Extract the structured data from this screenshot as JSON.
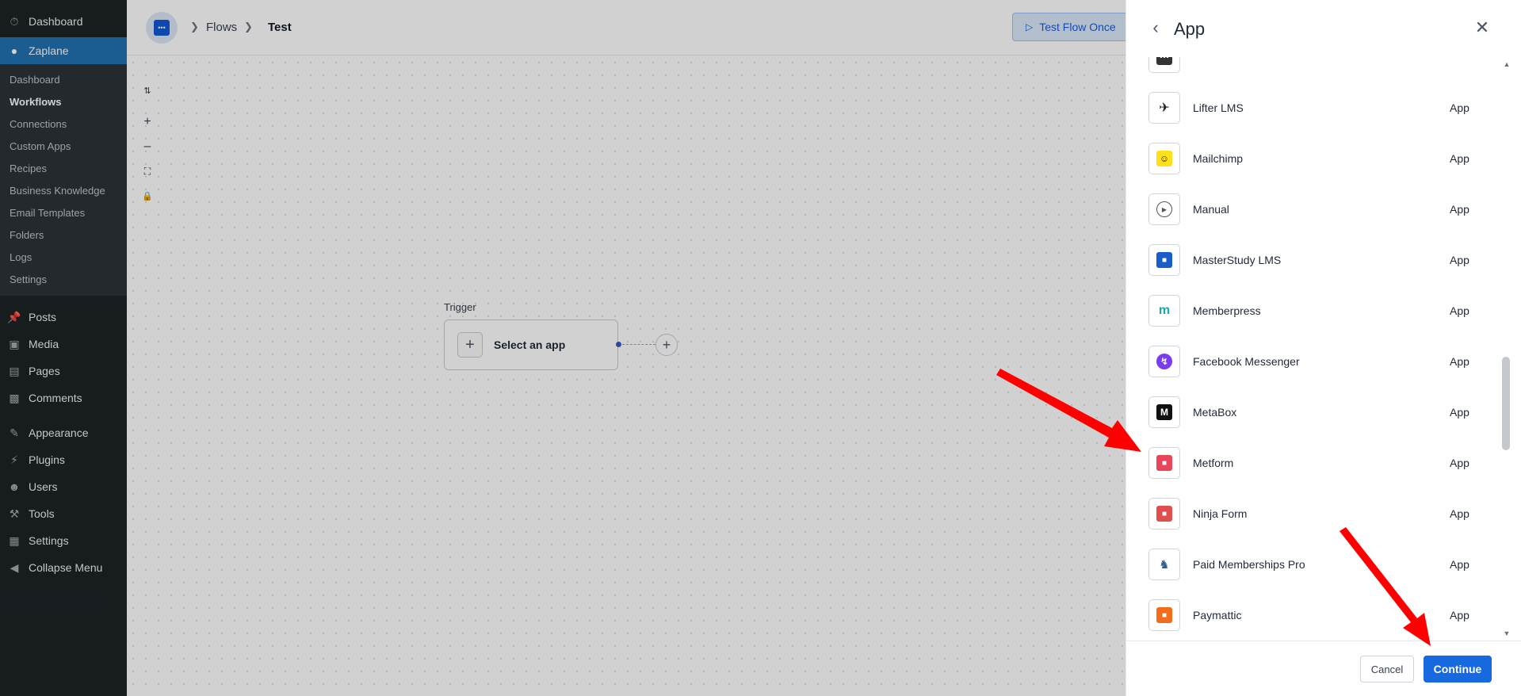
{
  "wp_menu": {
    "dashboard": "Dashboard",
    "zaplane": "Zaplane",
    "submenu": [
      "Dashboard",
      "Workflows",
      "Connections",
      "Custom Apps",
      "Recipes",
      "Business Knowledge",
      "Email Templates",
      "Folders",
      "Logs",
      "Settings"
    ],
    "current_submenu": "Workflows",
    "posts": "Posts",
    "media": "Media",
    "pages": "Pages",
    "comments": "Comments",
    "appearance": "Appearance",
    "plugins": "Plugins",
    "users": "Users",
    "tools": "Tools",
    "settings": "Settings",
    "collapse": "Collapse Menu"
  },
  "header": {
    "breadcrumb_flows": "Flows",
    "breadcrumb_current": "Test",
    "test_flow_label": "Test Flow Once"
  },
  "canvas": {
    "trigger_label": "Trigger",
    "select_app_label": "Select an app"
  },
  "drawer": {
    "title": "App",
    "apps": [
      {
        "name": "Lifter LMS",
        "type": "App",
        "icon": "lifterlms-icon",
        "color": "#222222"
      },
      {
        "name": "Mailchimp",
        "type": "App",
        "icon": "mailchimp-icon",
        "color": "#ffe01b"
      },
      {
        "name": "Manual",
        "type": "App",
        "icon": "manual-play-icon",
        "color": "#555555"
      },
      {
        "name": "MasterStudy LMS",
        "type": "App",
        "icon": "masterstudy-icon",
        "color": "#195ec8"
      },
      {
        "name": "Memberpress",
        "type": "App",
        "icon": "memberpress-icon",
        "color": "#1ba6b1"
      },
      {
        "name": "Facebook Messenger",
        "type": "App",
        "icon": "messenger-icon",
        "color": "#7b3cf0"
      },
      {
        "name": "MetaBox",
        "type": "App",
        "icon": "metabox-icon",
        "color": "#111111"
      },
      {
        "name": "Metform",
        "type": "App",
        "icon": "metform-icon",
        "color": "#e8455b"
      },
      {
        "name": "Ninja Form",
        "type": "App",
        "icon": "ninjaform-icon",
        "color": "#e04e4e"
      },
      {
        "name": "Paid Memberships Pro",
        "type": "App",
        "icon": "pmpro-icon",
        "color": "#2f5f8a"
      },
      {
        "name": "Paymattic",
        "type": "App",
        "icon": "paymattic-icon",
        "color": "#f26c1c"
      }
    ],
    "cancel_label": "Cancel",
    "continue_label": "Continue"
  }
}
